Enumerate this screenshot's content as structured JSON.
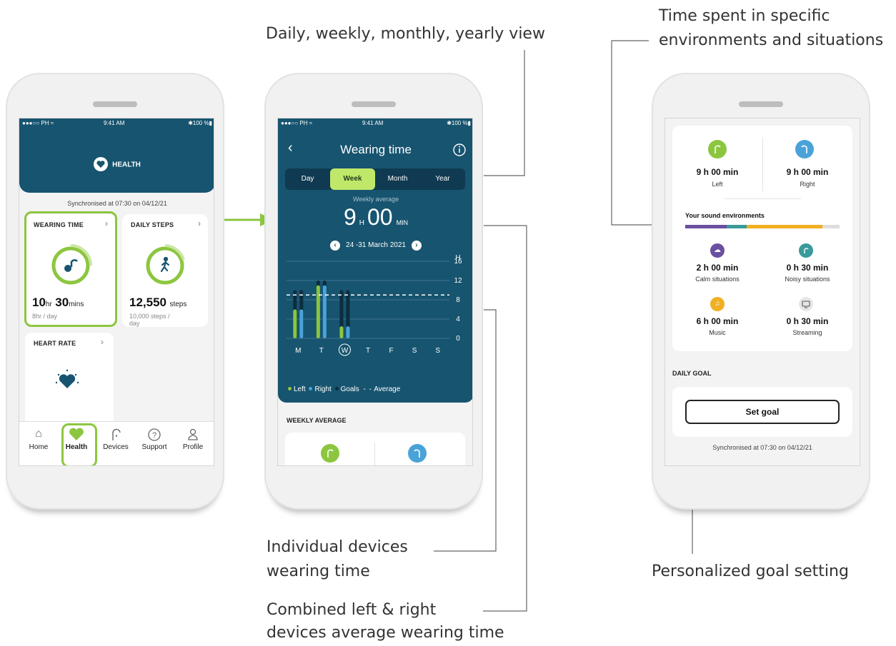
{
  "annotations": {
    "view_modes": "Daily, weekly, monthly, yearly view",
    "environments_line1": "Time spent in specific",
    "environments_line2": "environments and situations",
    "individual_line1": "Individual devices",
    "individual_line2": "wearing time",
    "combined_line1": "Combined left & right",
    "combined_line2": "devices average wearing time",
    "goal_setting": "Personalized goal setting"
  },
  "status_bar": {
    "carrier": "●●●○○ PH ≈",
    "time": "9:41 AM",
    "battery": "✱100 %▮"
  },
  "phone1": {
    "header_title": "HEALTH",
    "sync_text": "Synchronised at 07:30 on 04/12/21",
    "wearing_time": {
      "title": "WEARING TIME",
      "value_hr": "10",
      "hr_unit": "hr",
      "value_min": "30",
      "min_unit": "mins",
      "target": "8hr / day"
    },
    "daily_steps": {
      "title": "DAILY STEPS",
      "value": "12,550",
      "unit": "steps",
      "target_line1": "10,000 steps /",
      "target_line2": "day"
    },
    "heart_rate": {
      "title": "HEART RATE"
    },
    "nav": [
      {
        "label": "Home",
        "icon": "home-icon"
      },
      {
        "label": "Health",
        "icon": "heart-icon"
      },
      {
        "label": "Devices",
        "icon": "hearing-aid-icon"
      },
      {
        "label": "Support",
        "icon": "help-icon"
      },
      {
        "label": "Profile",
        "icon": "person-icon"
      }
    ]
  },
  "phone2": {
    "title": "Wearing time",
    "tabs": [
      "Day",
      "Week",
      "Month",
      "Year"
    ],
    "active_tab": "Week",
    "avg_label": "Weekly average",
    "avg_hours": "9",
    "hours_unit": "H",
    "avg_minutes": "00",
    "minutes_unit": "MIN",
    "date_range": "24 -31 March 2021",
    "section_title": "WEEKLY AVERAGE"
  },
  "phone3": {
    "left_time": "9 h 00 min",
    "left_label": "Left",
    "right_time": "9 h 00 min",
    "right_label": "Right",
    "env_title": "Your sound environments",
    "env_bar": [
      {
        "color": "#6b4fa0",
        "share": 0.27
      },
      {
        "color": "#3a9a9a",
        "share": 0.13
      },
      {
        "color": "#f0b022",
        "share": 0.49
      },
      {
        "color": "#dddddd",
        "share": 0.11
      }
    ],
    "environments": [
      {
        "time": "2 h 00 min",
        "label": "Calm situations",
        "color": "#6b4fa0",
        "icon": "calm-icon"
      },
      {
        "time": "0 h 30 min",
        "label": "Noisy situations",
        "color": "#3a9a9a",
        "icon": "noisy-icon"
      },
      {
        "time": "6 h 00 min",
        "label": "Music",
        "color": "#f0b022",
        "icon": "music-icon"
      },
      {
        "time": "0 h 30 min",
        "label": "Streaming",
        "color": "#e6e6e6",
        "icon": "tv-icon"
      }
    ],
    "daily_goal_title": "DAILY GOAL",
    "set_goal": "Set goal",
    "sync_text": "Synchronised at 07:30 on 04/12/21"
  },
  "chart_data": {
    "type": "bar",
    "categories": [
      "M",
      "T",
      "W",
      "T",
      "F",
      "S",
      "S"
    ],
    "highlighted_category": "W",
    "ylabel": "H",
    "yticks": [
      0,
      4,
      8,
      12,
      16
    ],
    "ylim": [
      0,
      16
    ],
    "average": 9,
    "legend": [
      "Left",
      "Right",
      "Goals",
      "Average"
    ],
    "series": [
      {
        "name": "Left",
        "color": "#8cc63f",
        "values": [
          6,
          11,
          2.5,
          null,
          null,
          null,
          null
        ]
      },
      {
        "name": "Right",
        "color": "#4aa3d8",
        "values": [
          6,
          11,
          2.5,
          null,
          null,
          null,
          null
        ]
      },
      {
        "name": "Goals",
        "color": "#0c2d3f",
        "values": [
          10,
          12,
          10,
          null,
          null,
          null,
          null
        ]
      }
    ]
  }
}
